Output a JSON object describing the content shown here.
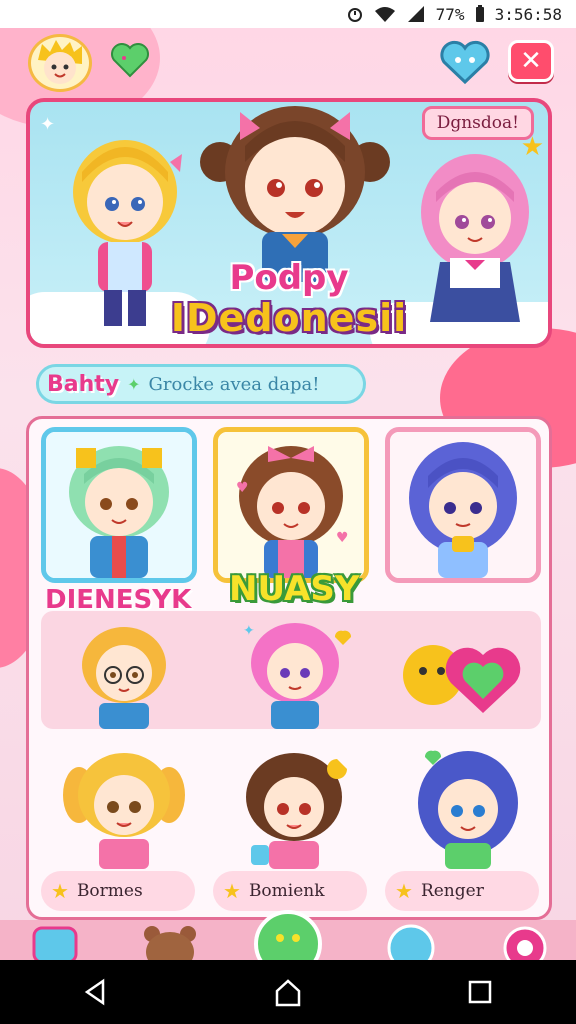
{
  "status_bar": {
    "battery_text": "77%",
    "clock_text": "3:56:58"
  },
  "banner": {
    "tag": "Dgnsdoa!",
    "title_line1": "Podpy",
    "title_line2": "IDedonesii"
  },
  "section": {
    "tag": "Bahty",
    "subtitle": "Grocke avea dapa!"
  },
  "panel": {
    "label_left": "DIENESYK",
    "label_center": "NUASY",
    "name_pills": [
      {
        "label": "Bormes"
      },
      {
        "label": "Bomienk"
      },
      {
        "label": "Renger"
      }
    ]
  },
  "colors": {
    "accent_pink": "#e83a8c",
    "accent_yellow": "#f7c21c",
    "close_red": "#ff4d6d"
  },
  "icons": {
    "top_left": "avatar-face-icon",
    "top_heart": "green-heart-icon",
    "top_right_heart": "blue-heart-icon",
    "close": "close-icon",
    "star": "star-icon"
  }
}
